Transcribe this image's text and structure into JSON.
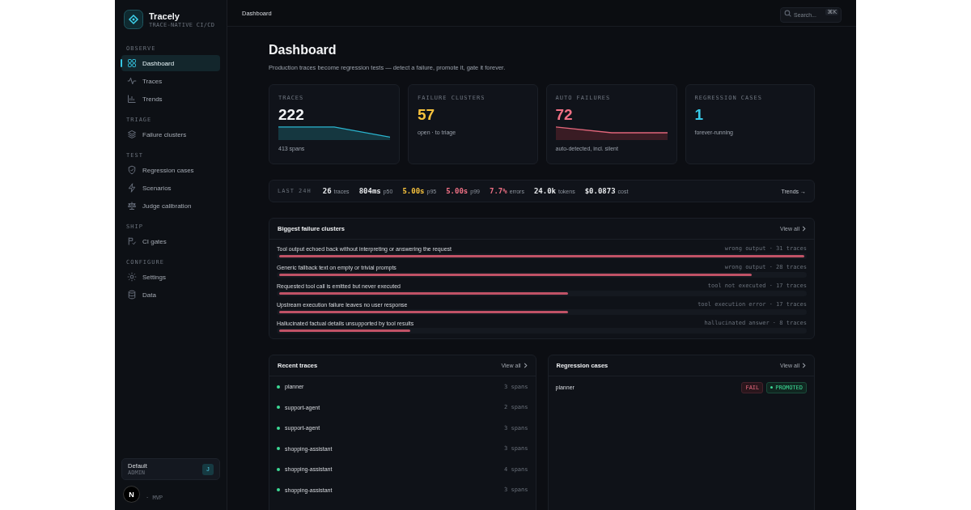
{
  "brand": {
    "name": "Tracely",
    "tagline": "TRACE-NATIVE CI/CD"
  },
  "sidebar": {
    "sections": [
      {
        "title": "OBSERVE",
        "items": [
          {
            "label": "Dashboard",
            "selected": true
          },
          {
            "label": "Traces",
            "selected": false
          },
          {
            "label": "Trends",
            "selected": false
          }
        ]
      },
      {
        "title": "TRIAGE",
        "items": [
          {
            "label": "Failure clusters",
            "selected": false
          }
        ]
      },
      {
        "title": "TEST",
        "items": [
          {
            "label": "Regression cases",
            "selected": false
          },
          {
            "label": "Scenarios",
            "selected": false
          },
          {
            "label": "Judge calibration",
            "selected": false
          }
        ]
      },
      {
        "title": "SHIP",
        "items": [
          {
            "label": "CI gates",
            "selected": false
          }
        ]
      },
      {
        "title": "CONFIGURE",
        "items": [
          {
            "label": "Settings",
            "selected": false
          },
          {
            "label": "Data",
            "selected": false
          }
        ]
      }
    ],
    "workspace": {
      "name": "Default",
      "role": "ADMIN",
      "avatar": "J"
    },
    "dev_badge": "N",
    "version": "· MVP"
  },
  "topbar": {
    "breadcrumb": "Dashboard",
    "search": {
      "placeholder": "Search...",
      "shortcut": "⌘K"
    }
  },
  "page": {
    "title": "Dashboard",
    "subtitle": "Production traces become regression tests — detect a failure, promote it, gate it forever."
  },
  "stats": [
    {
      "label": "TRACES",
      "value": "222",
      "color": "#f1f3f5",
      "caption": "413 spans"
    },
    {
      "label": "FAILURE CLUSTERS",
      "value": "57",
      "color": "#f5c13d",
      "caption": "open · to triage"
    },
    {
      "label": "AUTO FAILURES",
      "value": "72",
      "color": "#f07185",
      "caption": "auto-detected, incl. silent"
    },
    {
      "label": "REGRESSION CASES",
      "value": "1",
      "color": "#37c8e6",
      "caption": "forever-running"
    }
  ],
  "metrics": {
    "label": "LAST 24H",
    "items": [
      {
        "value": "26",
        "unit": "traces",
        "color": "#e6e8eb"
      },
      {
        "value": "804ms",
        "unit": "p50",
        "color": "#e6e8eb"
      },
      {
        "value": "5.00s",
        "unit": "p95",
        "color": "#f5c13d"
      },
      {
        "value": "5.00s",
        "unit": "p99",
        "color": "#f07185"
      },
      {
        "value": "7.7%",
        "unit": "errors",
        "color": "#f07185"
      },
      {
        "value": "24.0k",
        "unit": "tokens",
        "color": "#e6e8eb"
      },
      {
        "value": "$0.0873",
        "unit": "cost",
        "color": "#e6e8eb"
      }
    ],
    "link": "Trends →"
  },
  "clusters": {
    "title": "Biggest failure clusters",
    "link": "View all",
    "rows": [
      {
        "name": "Tool output echoed back without interpreting or answering the request",
        "meta": "wrong output · 31 traces",
        "level": 1
      },
      {
        "name": "Generic fallback text on empty or trivial prompts",
        "meta": "wrong output · 28 traces",
        "level": 0.9
      },
      {
        "name": "Requested tool call is emitted but never executed",
        "meta": "tool not executed · 17 traces",
        "level": 0.55
      },
      {
        "name": "Upstream execution failure leaves no user response",
        "meta": "tool execution error · 17 traces",
        "level": 0.55
      },
      {
        "name": "Hallucinated factual details unsupported by tool results",
        "meta": "hallucinated answer · 8 traces",
        "level": 0.25
      }
    ]
  },
  "recent_traces": {
    "title": "Recent traces",
    "link": "View all",
    "rows": [
      {
        "name": "planner",
        "spans": "3 spans",
        "color": "#3ddc97"
      },
      {
        "name": "support-agent",
        "spans": "2 spans",
        "color": "#3ddc97"
      },
      {
        "name": "support-agent",
        "spans": "3 spans",
        "color": "#3ddc97"
      },
      {
        "name": "shopping-assistant",
        "spans": "3 spans",
        "color": "#3ddc97"
      },
      {
        "name": "shopping-assistant",
        "spans": "4 spans",
        "color": "#3ddc97"
      },
      {
        "name": "shopping-assistant",
        "spans": "3 spans",
        "color": "#3ddc97"
      }
    ]
  },
  "regression_cases": {
    "title": "Regression cases",
    "link": "View all",
    "rows": [
      {
        "name": "planner",
        "status": "FAIL",
        "badge": "PROMOTED"
      }
    ]
  }
}
